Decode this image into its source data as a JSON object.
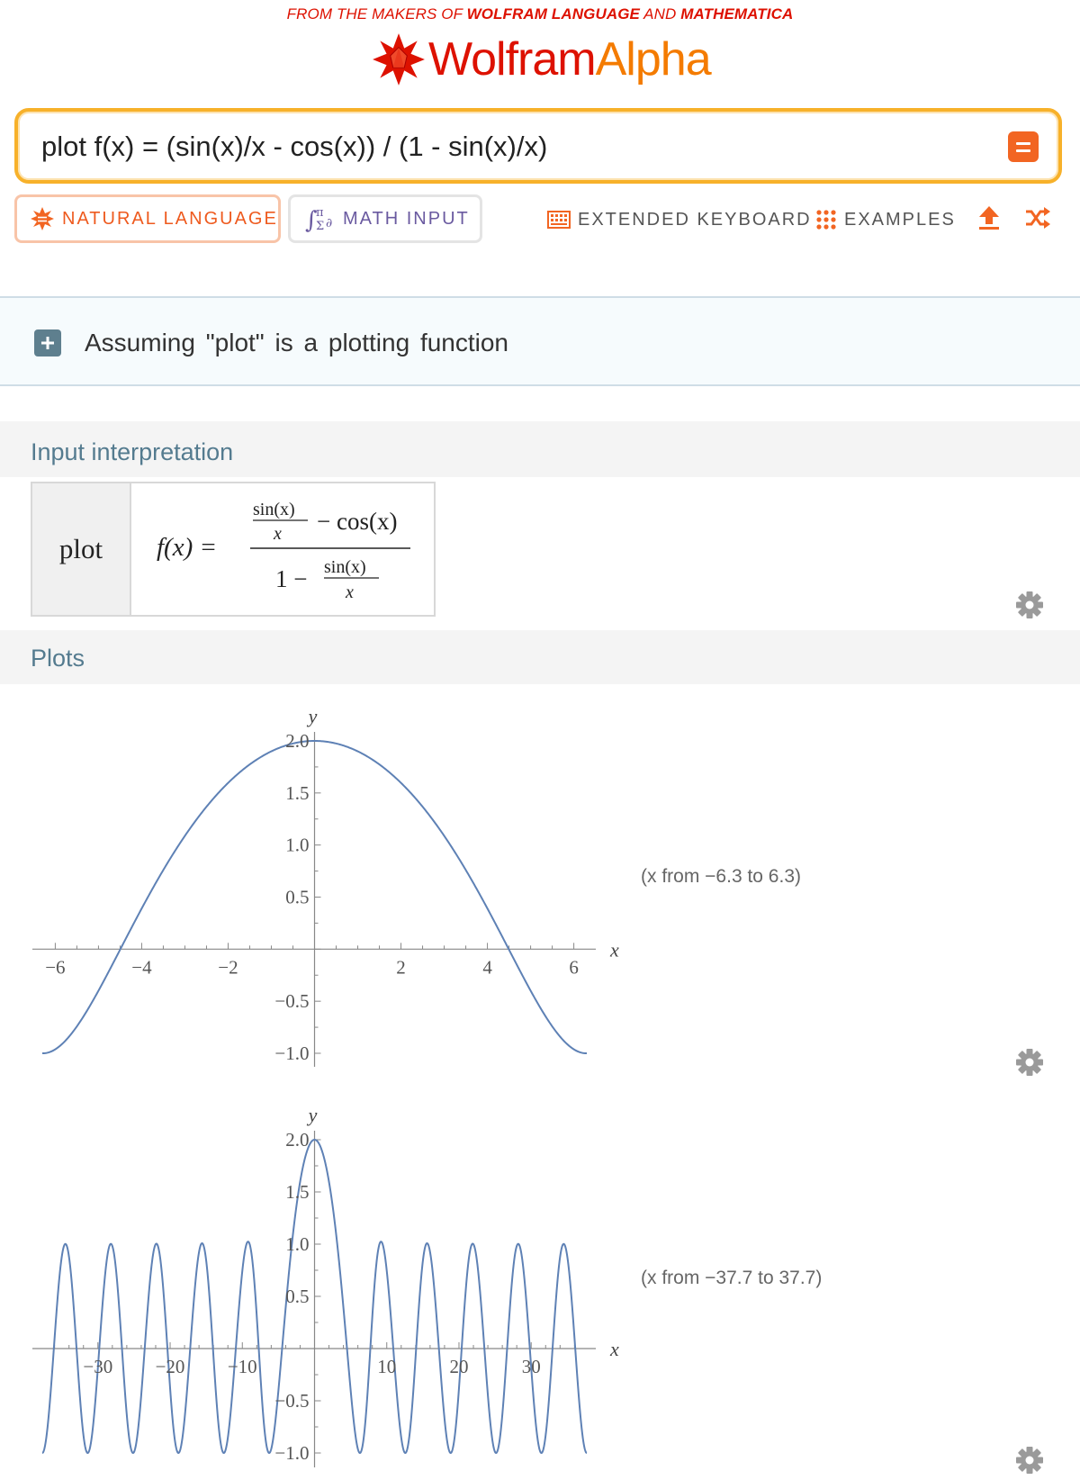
{
  "header": {
    "tagline_prefix": "FROM THE MAKERS OF",
    "tagline_brand1": "WOLFRAM LANGUAGE",
    "tagline_and": "AND",
    "tagline_brand2": "MATHEMATICA",
    "logo_part1": "Wolfram",
    "logo_part2": "Alpha",
    "logo_icon": "wolfram-spikey-icon",
    "brand_red": "#dd1100",
    "brand_orange": "#f47b00"
  },
  "search": {
    "value": "plot f(x) = (sin(x)/x - cos(x)) / (1 - sin(x)/x)",
    "compute_icon": "equals-icon"
  },
  "modes": {
    "natural_language": "NATURAL LANGUAGE",
    "math_input": "MATH INPUT"
  },
  "tools": {
    "extended_keyboard": "EXTENDED KEYBOARD",
    "examples": "EXAMPLES",
    "upload_icon": "upload-icon",
    "random_icon": "shuffle-icon"
  },
  "assumption": {
    "text": "Assuming  \"plot\"  is a plotting function"
  },
  "pods": {
    "interpretation": {
      "title": "Input interpretation",
      "keyword": "plot",
      "formula": {
        "lhs": "f(x) =",
        "num_frac_num": "sin(x)",
        "num_frac_den": "x",
        "num_rest": "− cos(x)",
        "den_lead": "1 −",
        "den_frac_num": "sin(x)",
        "den_frac_den": "x"
      }
    },
    "plots": {
      "title": "Plots",
      "caption1": "(x from −6.3 to 6.3)",
      "caption2": "(x from −37.7 to 37.7)"
    }
  },
  "chart_data": [
    {
      "type": "line",
      "function": "(sin(x)/x - cos(x)) / (1 - sin(x)/x)",
      "xlabel": "x",
      "ylabel": "y",
      "xlim": [
        -6.3,
        6.3
      ],
      "ylim": [
        -1.0,
        2.0
      ],
      "x_ticks": [
        "-6",
        "-4",
        "-2",
        "2",
        "4",
        "6"
      ],
      "y_ticks": [
        "-1.0",
        "-0.5",
        "0.5",
        "1.0",
        "1.5",
        "2.0"
      ],
      "series_color": "#5e81b5",
      "grid": false
    },
    {
      "type": "line",
      "function": "(sin(x)/x - cos(x)) / (1 - sin(x)/x)",
      "xlabel": "x",
      "ylabel": "y",
      "xlim": [
        -37.7,
        37.7
      ],
      "ylim": [
        -1.0,
        2.0
      ],
      "x_ticks": [
        "-30",
        "-20",
        "-10",
        "10",
        "20",
        "30"
      ],
      "y_ticks": [
        "-1.0",
        "-0.5",
        "0.5",
        "1.0",
        "1.5",
        "2.0"
      ],
      "series_color": "#5e81b5",
      "grid": false
    }
  ]
}
